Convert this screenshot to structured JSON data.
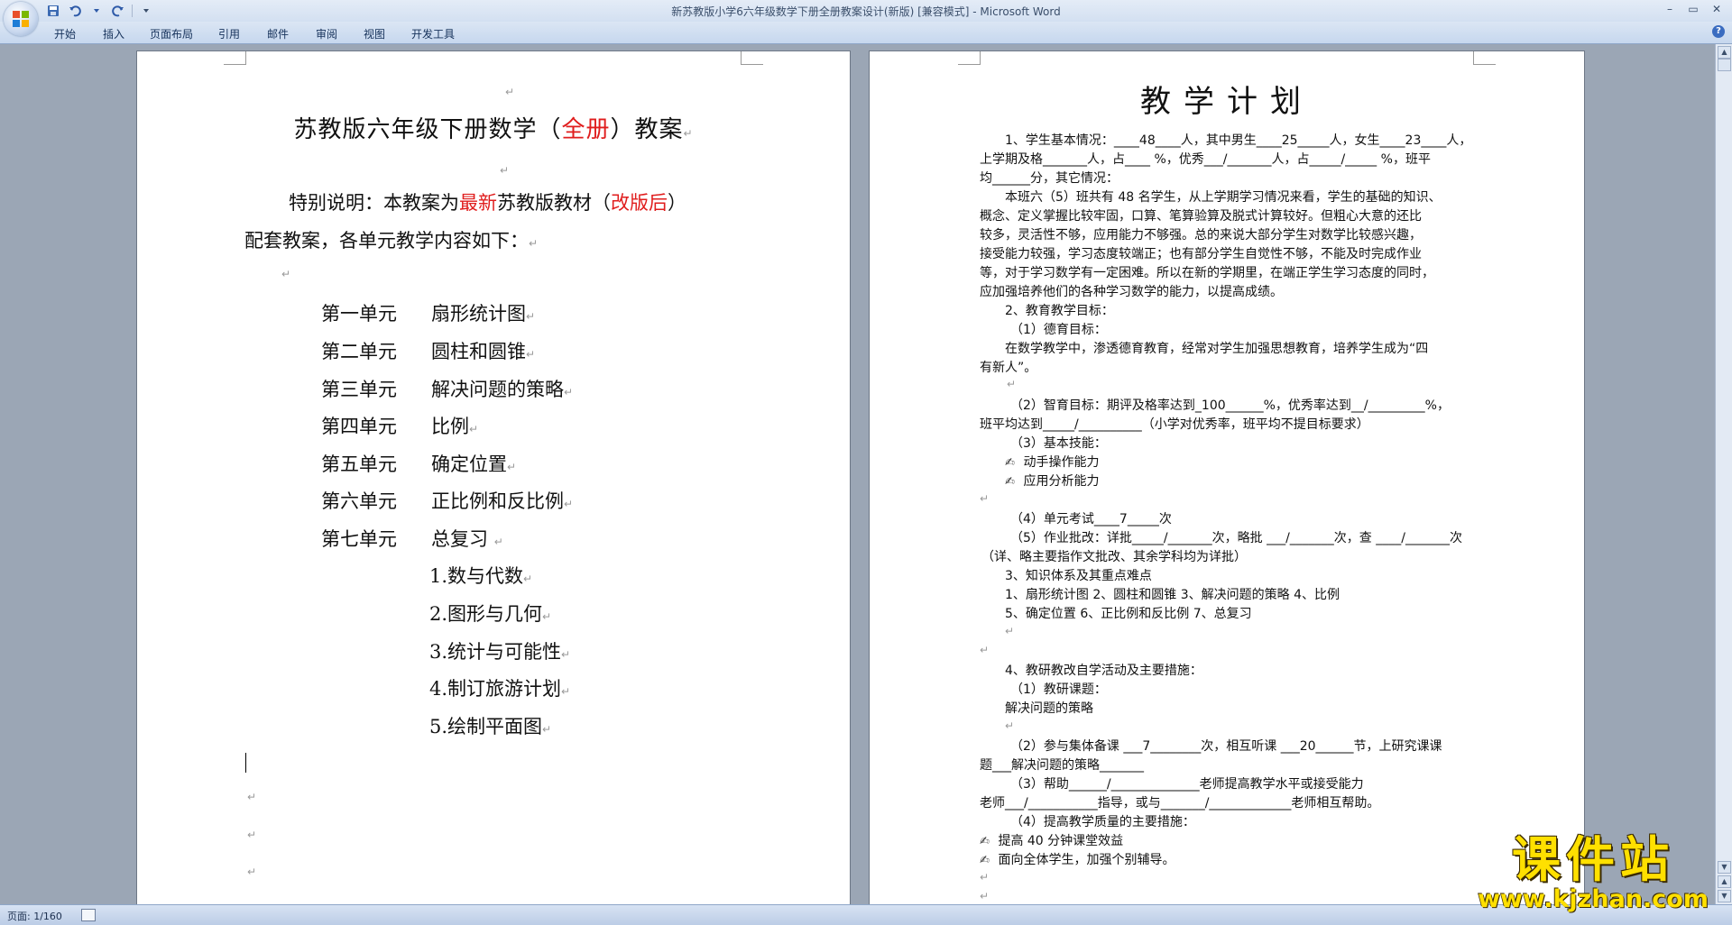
{
  "window": {
    "title": "新苏教版小学6六年级数学下册全册教案设计(新版) [兼容模式] - Microsoft Word",
    "controls": [
      "–",
      "▭",
      "✕"
    ]
  },
  "ribbon": {
    "tabs": [
      "开始",
      "插入",
      "页面布局",
      "引用",
      "邮件",
      "审阅",
      "视图",
      "开发工具"
    ],
    "help": "?"
  },
  "page1": {
    "title_pre": "苏教版六年级下册数学（",
    "title_red": "全册",
    "title_post": "）教案",
    "note1_a": "特别说明：本教案为",
    "note1_red1": "最新",
    "note1_b": "苏教版教材（",
    "note1_red2": "改版后",
    "note1_c": "）",
    "note2": "配套教案，各单元教学内容如下：",
    "units": [
      {
        "n": "第一单元",
        "t": "扇形统计图"
      },
      {
        "n": "第二单元",
        "t": "圆柱和圆锥"
      },
      {
        "n": "第三单元",
        "t": "解决问题的策略"
      },
      {
        "n": "第四单元",
        "t": "比例"
      },
      {
        "n": "第五单元",
        "t": "确定位置"
      },
      {
        "n": "第六单元",
        "t": "正比例和反比例"
      },
      {
        "n": "第七单元",
        "t": "总复习"
      }
    ],
    "review": [
      "1.数与代数",
      "2.图形与几何",
      "3.统计与可能性",
      "4.制订旅游计划",
      "5.绘制平面图"
    ]
  },
  "page2": {
    "title": "教学计划",
    "l1": "1、学生基本情况：____48____人，其中男生____25_____人，女生____23____人，",
    "l2": "上学期及格_______人，占____ %，优秀___/_______人，占_____/_____ %，班平",
    "l3": "均______分，其它情况：",
    "para": [
      "本班六（5）班共有 48 名学生，从上学期学习情况来看，学生的基础的知识、",
      "概念、定义掌握比较牢固，口算、笔算验算及脱式计算较好。但粗心大意的还比",
      "较多，灵活性不够，应用能力不够强。总的来说大部分学生对数学比较感兴趣，",
      "接受能力较强，学习态度较端正；也有部分学生自觉性不够，不能及时完成作业",
      "等，对于学习数学有一定困难。所以在新的学期里，在端正学生学习态度的同时，",
      "应加强培养他们的各种学习数学的能力，以提高成绩。"
    ],
    "g2": "2、教育教学目标：",
    "g2_1": "（1）德育目标：",
    "g2_1a": "在数学教学中，渗透德育教育，经常对学生加强思想教育，培养学生成为“四",
    "g2_1b": "有新人”。",
    "g2_2a": "（2）智育目标：期评及格率达到_100______%，优秀率达到__/_________%，",
    "g2_2b": "班平均达到_____/__________（小学对优秀率，班平均不提目标要求）",
    "g2_3": "（3）基本技能：",
    "skills": [
      "动手操作能力",
      "应用分析能力"
    ],
    "g2_4": "（4）单元考试____7_____次",
    "g2_5a": "（5）作业批改：详批_____/_______次，略批 ___/_______次，查 ____/_______次",
    "g2_5b": "（详、略主要指作文批改、其余学科均为详批）",
    "g3": "3、知识体系及其重点难点",
    "k1": "1、扇形统计图        2、圆柱和圆锥         3、解决问题的策略          4、比例",
    "k2": "5、确定位置        6、正比例和反比例        7、总复习",
    "g4": "4、教研教改自学活动及主要措施：",
    "g4_1": "（1）教研课题：",
    "g4_1a": "解决问题的策略",
    "g4_2a": "（2）参与集体备课 ___7________次，相互听课 ___20______节，上研究课课",
    "g4_2b": "题___解决问题的策略_______",
    "g4_3a": "（3）帮助______/______________老师提高教学水平或接受能力",
    "g4_3b": "老师___/___________指导，或与_______/_____________老师相互帮助。",
    "g4_4": "（4）提高教学质量的主要措施：",
    "measures": [
      "提高 40 分钟课堂效益",
      "面向全体学生，加强个别辅导。"
    ]
  },
  "status": {
    "page": "页面: 1/160"
  },
  "watermark": {
    "cn": "课件站",
    "url": "www.kjzhan.com"
  }
}
